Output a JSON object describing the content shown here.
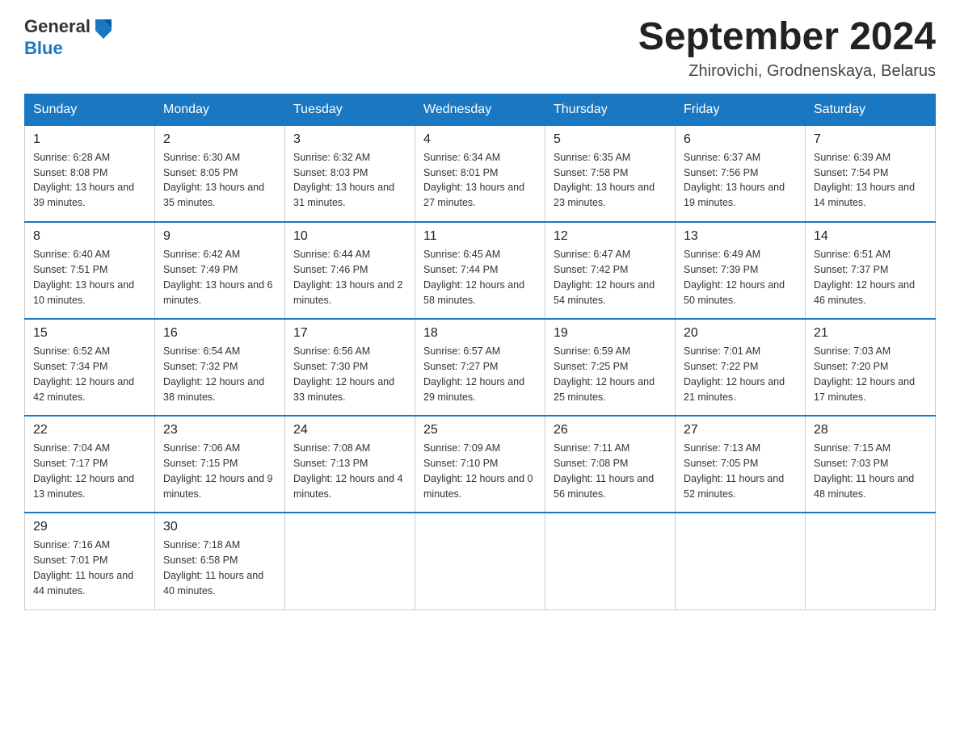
{
  "header": {
    "logo_line1": "General",
    "logo_line2": "Blue",
    "month_title": "September 2024",
    "location": "Zhirovichi, Grodnenskaya, Belarus"
  },
  "days_of_week": [
    "Sunday",
    "Monday",
    "Tuesday",
    "Wednesday",
    "Thursday",
    "Friday",
    "Saturday"
  ],
  "weeks": [
    [
      {
        "num": "1",
        "sunrise": "6:28 AM",
        "sunset": "8:08 PM",
        "daylight": "13 hours and 39 minutes."
      },
      {
        "num": "2",
        "sunrise": "6:30 AM",
        "sunset": "8:05 PM",
        "daylight": "13 hours and 35 minutes."
      },
      {
        "num": "3",
        "sunrise": "6:32 AM",
        "sunset": "8:03 PM",
        "daylight": "13 hours and 31 minutes."
      },
      {
        "num": "4",
        "sunrise": "6:34 AM",
        "sunset": "8:01 PM",
        "daylight": "13 hours and 27 minutes."
      },
      {
        "num": "5",
        "sunrise": "6:35 AM",
        "sunset": "7:58 PM",
        "daylight": "13 hours and 23 minutes."
      },
      {
        "num": "6",
        "sunrise": "6:37 AM",
        "sunset": "7:56 PM",
        "daylight": "13 hours and 19 minutes."
      },
      {
        "num": "7",
        "sunrise": "6:39 AM",
        "sunset": "7:54 PM",
        "daylight": "13 hours and 14 minutes."
      }
    ],
    [
      {
        "num": "8",
        "sunrise": "6:40 AM",
        "sunset": "7:51 PM",
        "daylight": "13 hours and 10 minutes."
      },
      {
        "num": "9",
        "sunrise": "6:42 AM",
        "sunset": "7:49 PM",
        "daylight": "13 hours and 6 minutes."
      },
      {
        "num": "10",
        "sunrise": "6:44 AM",
        "sunset": "7:46 PM",
        "daylight": "13 hours and 2 minutes."
      },
      {
        "num": "11",
        "sunrise": "6:45 AM",
        "sunset": "7:44 PM",
        "daylight": "12 hours and 58 minutes."
      },
      {
        "num": "12",
        "sunrise": "6:47 AM",
        "sunset": "7:42 PM",
        "daylight": "12 hours and 54 minutes."
      },
      {
        "num": "13",
        "sunrise": "6:49 AM",
        "sunset": "7:39 PM",
        "daylight": "12 hours and 50 minutes."
      },
      {
        "num": "14",
        "sunrise": "6:51 AM",
        "sunset": "7:37 PM",
        "daylight": "12 hours and 46 minutes."
      }
    ],
    [
      {
        "num": "15",
        "sunrise": "6:52 AM",
        "sunset": "7:34 PM",
        "daylight": "12 hours and 42 minutes."
      },
      {
        "num": "16",
        "sunrise": "6:54 AM",
        "sunset": "7:32 PM",
        "daylight": "12 hours and 38 minutes."
      },
      {
        "num": "17",
        "sunrise": "6:56 AM",
        "sunset": "7:30 PM",
        "daylight": "12 hours and 33 minutes."
      },
      {
        "num": "18",
        "sunrise": "6:57 AM",
        "sunset": "7:27 PM",
        "daylight": "12 hours and 29 minutes."
      },
      {
        "num": "19",
        "sunrise": "6:59 AM",
        "sunset": "7:25 PM",
        "daylight": "12 hours and 25 minutes."
      },
      {
        "num": "20",
        "sunrise": "7:01 AM",
        "sunset": "7:22 PM",
        "daylight": "12 hours and 21 minutes."
      },
      {
        "num": "21",
        "sunrise": "7:03 AM",
        "sunset": "7:20 PM",
        "daylight": "12 hours and 17 minutes."
      }
    ],
    [
      {
        "num": "22",
        "sunrise": "7:04 AM",
        "sunset": "7:17 PM",
        "daylight": "12 hours and 13 minutes."
      },
      {
        "num": "23",
        "sunrise": "7:06 AM",
        "sunset": "7:15 PM",
        "daylight": "12 hours and 9 minutes."
      },
      {
        "num": "24",
        "sunrise": "7:08 AM",
        "sunset": "7:13 PM",
        "daylight": "12 hours and 4 minutes."
      },
      {
        "num": "25",
        "sunrise": "7:09 AM",
        "sunset": "7:10 PM",
        "daylight": "12 hours and 0 minutes."
      },
      {
        "num": "26",
        "sunrise": "7:11 AM",
        "sunset": "7:08 PM",
        "daylight": "11 hours and 56 minutes."
      },
      {
        "num": "27",
        "sunrise": "7:13 AM",
        "sunset": "7:05 PM",
        "daylight": "11 hours and 52 minutes."
      },
      {
        "num": "28",
        "sunrise": "7:15 AM",
        "sunset": "7:03 PM",
        "daylight": "11 hours and 48 minutes."
      }
    ],
    [
      {
        "num": "29",
        "sunrise": "7:16 AM",
        "sunset": "7:01 PM",
        "daylight": "11 hours and 44 minutes."
      },
      {
        "num": "30",
        "sunrise": "7:18 AM",
        "sunset": "6:58 PM",
        "daylight": "11 hours and 40 minutes."
      },
      null,
      null,
      null,
      null,
      null
    ]
  ]
}
